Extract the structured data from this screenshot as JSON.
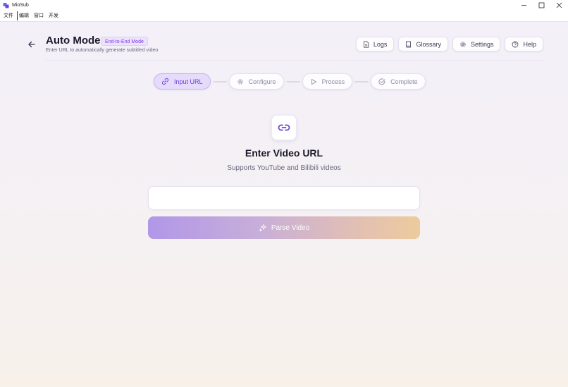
{
  "window": {
    "title": "MioSub"
  },
  "menu": {
    "items": [
      "文件",
      "编辑",
      "窗口",
      "开发"
    ]
  },
  "header": {
    "title": "Auto Mode",
    "badge": "End-to-End Mode",
    "subtitle": "Enter URL to automatically generate subtitled video",
    "actions": {
      "logs": "Logs",
      "glossary": "Glossary",
      "settings": "Settings",
      "help": "Help"
    }
  },
  "stepper": {
    "steps": [
      {
        "label": "Input URL",
        "icon": "link-icon",
        "active": true
      },
      {
        "label": "Configure",
        "icon": "gear-icon",
        "active": false
      },
      {
        "label": "Process",
        "icon": "play-icon",
        "active": false
      },
      {
        "label": "Complete",
        "icon": "check-circle-icon",
        "active": false
      }
    ]
  },
  "main": {
    "heading": "Enter Video URL",
    "subheading": "Supports YouTube and Bilibili videos",
    "url_input": {
      "value": "",
      "placeholder": ""
    },
    "parse_button": "Parse Video"
  },
  "colors": {
    "accent": "#7c3aed",
    "active_step_bg": "#e6dbfa",
    "button_gradient_start": "#ab8fe7",
    "button_gradient_end": "#ecc895"
  }
}
